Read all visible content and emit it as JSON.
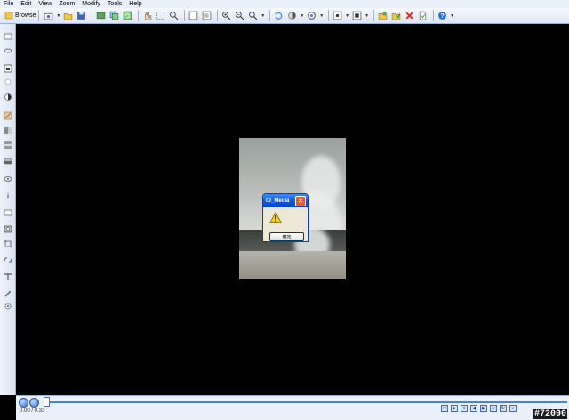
{
  "menu": [
    "File",
    "Edit",
    "View",
    "Zoom",
    "Modify",
    "Tools",
    "Help"
  ],
  "toolbar": {
    "browse_label": "Browse",
    "icons": [
      "browse-icon",
      "capture-icon",
      "open-folder-icon",
      "save-icon",
      "slideshow-icon",
      "copy-icon",
      "refresh-icon",
      "hand-icon",
      "select-icon",
      "magnifier-icon",
      "fit-icon",
      "actual-size-icon",
      "zoom-in-icon",
      "zoom-out-icon",
      "zoom-icon",
      "rotate-icon",
      "adjust-icon",
      "filter-icon",
      "frame-icon",
      "effects-icon",
      "edit-icon",
      "acquire-icon",
      "delete-icon",
      "properties-icon",
      "help-icon"
    ]
  },
  "leftbar": {
    "tools": [
      "select-tool-icon",
      "lasso-tool-icon",
      "crop-tool-icon",
      "color-tool-icon",
      "contrast-tool-icon",
      "brush-tool-icon",
      "fill-tool-icon",
      "stamp-tool-icon",
      "eraser-tool-icon",
      "blur-tool-icon",
      "pencil-tool-icon",
      "shape-tool-icon",
      "camera-tool-icon",
      "transform-tool-icon",
      "link-tool-icon",
      "text-tool-icon",
      "eyedropper-tool-icon",
      "settings-tool-icon"
    ]
  },
  "dialog": {
    "title": "ID_Media",
    "button_label": "確定"
  },
  "timeline": {
    "time": "0.00 / 0.33",
    "progress": 0
  },
  "watermark": "#72090",
  "colors": {
    "background": "#000000",
    "accent": "#3a78d8",
    "dialog_title": "#0a55e0"
  }
}
